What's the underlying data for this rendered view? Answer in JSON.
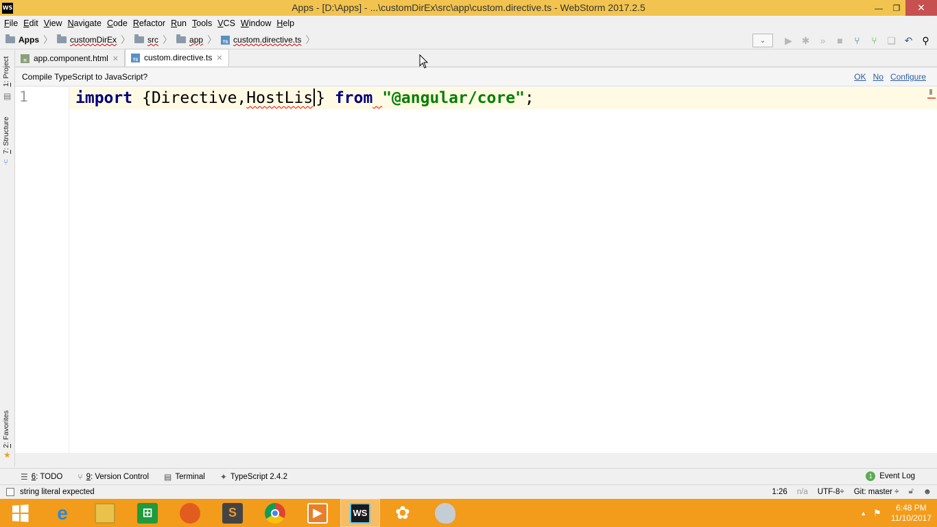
{
  "window": {
    "app_icon": "WS",
    "title": "Apps - [D:\\Apps] - ...\\customDirEx\\src\\app\\custom.directive.ts - WebStorm 2017.2.5",
    "minimize_glyph": "—",
    "restore_glyph": "❐",
    "close_glyph": "✕"
  },
  "menu": {
    "items": [
      {
        "u": "F",
        "rest": "ile"
      },
      {
        "u": "E",
        "rest": "dit"
      },
      {
        "u": "V",
        "rest": "iew"
      },
      {
        "u": "N",
        "rest": "avigate"
      },
      {
        "u": "C",
        "rest": "ode"
      },
      {
        "u": "R",
        "rest": "efactor"
      },
      {
        "u": "R",
        "rest": "un"
      },
      {
        "u": "T",
        "rest": "ools"
      },
      {
        "u": "V",
        "rest": "CS"
      },
      {
        "u": "W",
        "rest": "indow"
      },
      {
        "u": "H",
        "rest": "elp"
      }
    ]
  },
  "breadcrumbs": [
    {
      "label": "Apps",
      "icon": "folder-icon"
    },
    {
      "label": "customDirEx",
      "icon": "folder-icon"
    },
    {
      "label": "src",
      "icon": "folder-icon"
    },
    {
      "label": "app",
      "icon": "folder-icon"
    },
    {
      "label": "custom.directive.ts",
      "icon": "ts-file-icon"
    }
  ],
  "tabs": [
    {
      "label": "app.component.html",
      "icon": "html-file-icon",
      "active": false
    },
    {
      "label": "custom.directive.ts",
      "icon": "ts-file-icon",
      "active": true
    }
  ],
  "notification": {
    "message": "Compile TypeScript to JavaScript?",
    "ok": "OK",
    "no": "No",
    "configure": "Configure"
  },
  "editor": {
    "line_number": "1",
    "tokens": {
      "kw_import": "import",
      "brace_open": "{",
      "ident1": "Directive,",
      "ident2": "HostLis",
      "brace_close": "}",
      "kw_from": "from",
      "space_err": " ",
      "string": "\"@angular/core\"",
      "semi": ";"
    }
  },
  "left_strip": {
    "project_num": "1",
    "project_label": ": Project",
    "structure_num": "7",
    "structure_label": ": Structure",
    "favorites_num": "2",
    "favorites_label": ": Favorites"
  },
  "bottom_tools": [
    {
      "num": "6",
      "label": ": TODO",
      "icon": "todo-icon"
    },
    {
      "num": "9",
      "label": ": Version Control",
      "icon": "version-control-icon"
    },
    {
      "num": "",
      "label": "Terminal",
      "icon": "terminal-icon"
    },
    {
      "num": "",
      "label": "TypeScript 2.4.2",
      "icon": "typescript-icon"
    }
  ],
  "event_log": {
    "badge": "1",
    "label": "Event Log"
  },
  "status": {
    "message": "string literal expected",
    "position": "1:26",
    "na": "n/a",
    "encoding": "UTF-8÷",
    "git": "Git: master ÷"
  },
  "taskbar": {
    "time": "6:48 PM",
    "date": "11/10/2017",
    "apps": [
      "internet-explorer-icon",
      "file-explorer-icon",
      "store-icon",
      "firefox-icon",
      "sublime-icon",
      "chrome-icon",
      "media-player-icon",
      "webstorm-icon",
      "flower-app-icon",
      "paint-icon"
    ]
  },
  "colors": {
    "titlebar": "#f2c44f",
    "taskbar": "#f39b1b",
    "keyword": "#000080",
    "string": "#008000",
    "link": "#2a5ea6"
  }
}
